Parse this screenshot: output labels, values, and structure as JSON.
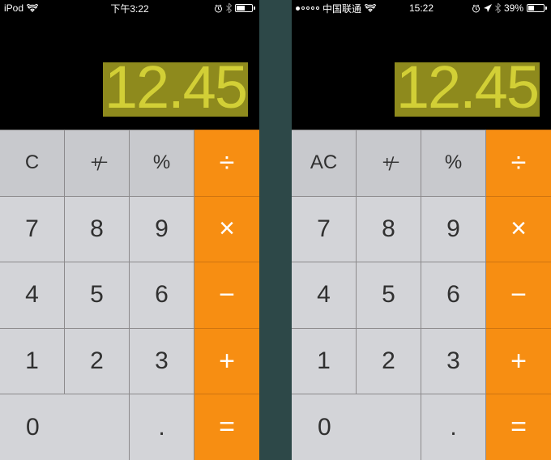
{
  "phones": [
    {
      "status": {
        "device": "iPod",
        "signal_dots": null,
        "carrier": null,
        "show_wifi": true,
        "time": "下午3:22",
        "show_alarm": true,
        "show_location": false,
        "show_bluetooth": true,
        "battery_percent_text": "",
        "battery_fill_pct": 55
      },
      "display": "12.45",
      "keys": {
        "clear": "C",
        "plusminus": "+/−",
        "percent": "%",
        "divide": "÷",
        "k7": "7",
        "k8": "8",
        "k9": "9",
        "multiply": "×",
        "k4": "4",
        "k5": "5",
        "k6": "6",
        "minus": "−",
        "k1": "1",
        "k2": "2",
        "k3": "3",
        "plus": "+",
        "k0": "0",
        "dot": ".",
        "equals": "="
      }
    },
    {
      "status": {
        "device": null,
        "signal_dots": {
          "filled": 1,
          "total": 5
        },
        "carrier": "中国联通",
        "show_wifi": true,
        "time": "15:22",
        "show_alarm": true,
        "show_location": true,
        "show_bluetooth": true,
        "battery_percent_text": "39%",
        "battery_fill_pct": 39
      },
      "display": "12.45",
      "keys": {
        "clear": "AC",
        "plusminus": "+/−",
        "percent": "%",
        "divide": "÷",
        "k7": "7",
        "k8": "8",
        "k9": "9",
        "multiply": "×",
        "k4": "4",
        "k5": "5",
        "k6": "6",
        "minus": "−",
        "k1": "1",
        "k2": "2",
        "k3": "3",
        "plus": "+",
        "k0": "0",
        "dot": ".",
        "equals": "="
      }
    }
  ]
}
